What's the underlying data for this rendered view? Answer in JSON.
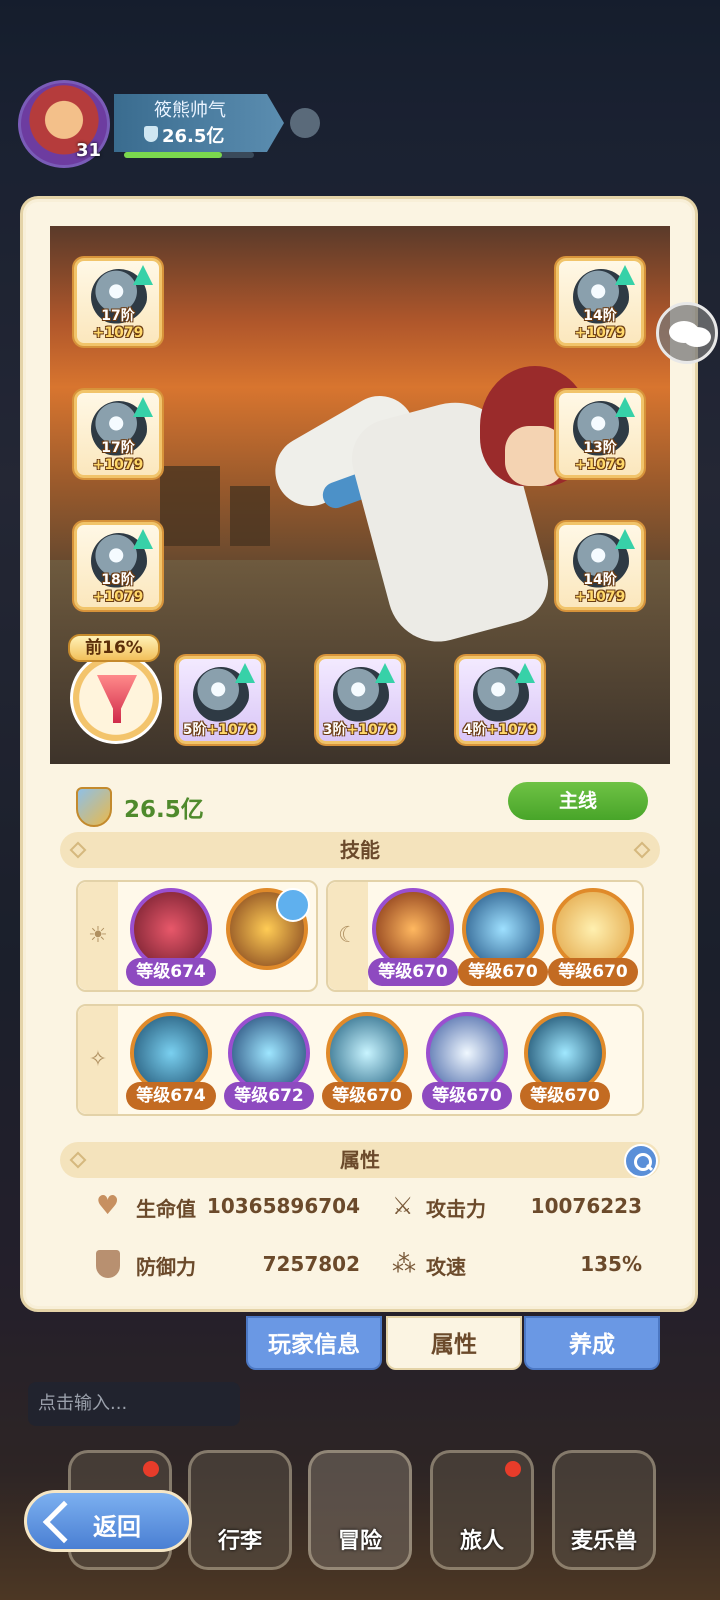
{
  "player": {
    "name": "筱熊帅气",
    "power": "26.5亿",
    "level": "31"
  },
  "equipment": {
    "left": [
      {
        "name": "bow-gear-icon",
        "stage": "17阶",
        "bonus": "+1079"
      },
      {
        "name": "armor-gear-icon",
        "stage": "17阶",
        "bonus": "+1079"
      },
      {
        "name": "belt-gear-icon",
        "stage": "18阶",
        "bonus": "+1079"
      }
    ],
    "right": [
      {
        "name": "helmet-gear-icon",
        "stage": "14阶",
        "bonus": "+1079"
      },
      {
        "name": "gloves-gear-icon",
        "stage": "13阶",
        "bonus": "+1079"
      },
      {
        "name": "boots-gear-icon",
        "stage": "14阶",
        "bonus": "+1079"
      }
    ],
    "bottom": [
      {
        "name": "ring-gear-icon",
        "stage": "5阶",
        "bonus": "+1079"
      },
      {
        "name": "necklace-gear-icon",
        "stage": "3阶",
        "bonus": "+1079"
      },
      {
        "name": "amulet-gear-icon",
        "stage": "4阶",
        "bonus": "+1079"
      }
    ],
    "consumable_badge": "前16%"
  },
  "power_line": {
    "value": "26.5亿",
    "mainline_button": "主线"
  },
  "skills": {
    "header": "技能",
    "sun_group": [
      {
        "level": "等级674",
        "color": "purple"
      }
    ],
    "moon_group": [
      {
        "level": "等级670",
        "color": "purple"
      },
      {
        "level": "等级670",
        "color": "orange"
      },
      {
        "level": "等级670",
        "color": "orange"
      }
    ],
    "star_group": [
      {
        "level": "等级674",
        "color": "orange"
      },
      {
        "level": "等级672",
        "color": "purple"
      },
      {
        "level": "等级670",
        "color": "orange"
      },
      {
        "level": "等级670",
        "color": "purple"
      },
      {
        "level": "等级670",
        "color": "orange"
      }
    ]
  },
  "attributes": {
    "header": "属性",
    "hp_label": "生命值",
    "hp_value": "10365896704",
    "atk_label": "攻击力",
    "atk_value": "10076223",
    "def_label": "防御力",
    "def_value": "7257802",
    "spd_label": "攻速",
    "spd_value": "135%"
  },
  "tabs": {
    "player_info": "玩家信息",
    "attributes": "属性",
    "cultivate": "养成"
  },
  "chat_input": {
    "placeholder": "点击输入..."
  },
  "nav": {
    "luggage": "行李",
    "adventure": "冒险",
    "traveler": "旅人",
    "beast": "麦乐兽"
  },
  "back_button": "返回"
}
